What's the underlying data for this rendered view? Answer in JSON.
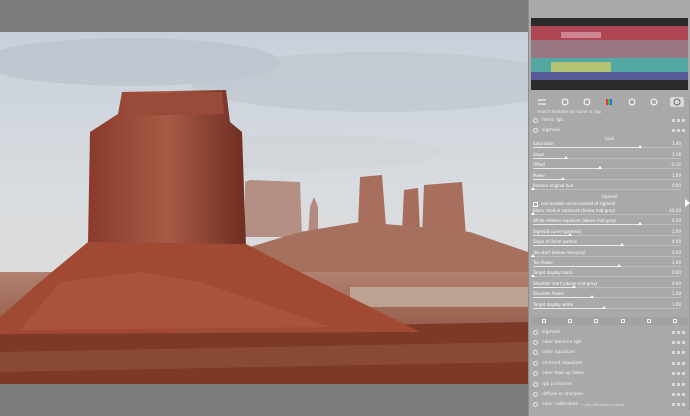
{
  "panel": {
    "search_placeholder": "search modules by name or tag",
    "modules_top": [
      {
        "name": "filmic rgb"
      },
      {
        "name": "sigmoid"
      }
    ],
    "section_look": "Look",
    "section_sigmoid": "Sigmoid",
    "sliders": [
      {
        "label": "Saturation",
        "value": "1.40",
        "fill": 0.72
      },
      {
        "label": "Slope",
        "value": "1.16",
        "fill": 0.22
      },
      {
        "label": "Offset",
        "value": "-0.15",
        "fill": 0.45
      },
      {
        "label": "Power",
        "value": "1.00",
        "fill": 0.2
      },
      {
        "label": "Restore original hue",
        "value": "0.00",
        "fill": 0.0
      }
    ],
    "checkbox_label": "use tunable curve instead of sigmoid",
    "sliders2": [
      {
        "label": "Black relative exposure (below mid-grey)",
        "value": "-10.00",
        "fill": 0.0
      },
      {
        "label": "White relative exposure (above mid-grey)",
        "value": "6.50",
        "fill": 0.72
      },
      {
        "label": "Sigmoid curve (gamma)",
        "value": "2.00",
        "fill": 0.25
      },
      {
        "label": "Slope of linear portion",
        "value": "4.00",
        "fill": 0.6
      },
      {
        "label": "Toe start (below mid-grey)",
        "value": "0.00",
        "fill": 0.0
      },
      {
        "label": "Toe Power",
        "value": "2.00",
        "fill": 0.58
      },
      {
        "label": "Target display black",
        "value": "0.00",
        "fill": 0.0
      },
      {
        "label": "Shoulder start (above mid-grey)",
        "value": "0.00",
        "fill": 0.28
      },
      {
        "label": "Shoulder Power",
        "value": "1.00",
        "fill": 0.4
      },
      {
        "label": "Target display white",
        "value": "1.00",
        "fill": 0.48
      }
    ],
    "modules_bottom": [
      {
        "name": "sigmoid"
      },
      {
        "name": "color balance rgb"
      },
      {
        "name": "color equalizer"
      },
      {
        "name": "contrast equalizer"
      },
      {
        "name": "color look up table"
      },
      {
        "name": "rgb primaries"
      },
      {
        "name": "diffuse or sharpen"
      },
      {
        "name": "color calibration"
      }
    ],
    "calibration_note": "• (not reference picture)"
  },
  "colors": {
    "panel_bg": "#a9a9a9",
    "frame_bg": "#7b7b7b",
    "accent": "#ffffff"
  }
}
